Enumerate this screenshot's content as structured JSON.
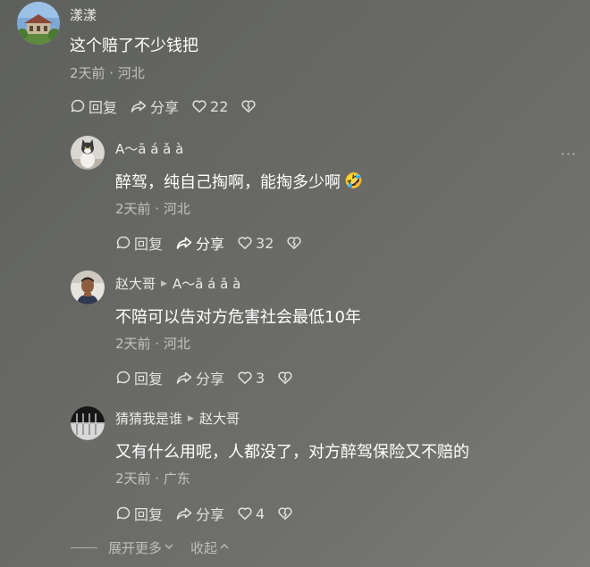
{
  "comments": [
    {
      "username": "漾漾",
      "text": "这个赔了不少钱把",
      "meta": "2天前 · 河北",
      "reply_label": "回复",
      "share_label": "分享",
      "like_count": "22"
    },
    {
      "username": "A～ā á ǎ à",
      "text": "醉驾，纯自己掏啊，能掏多少啊",
      "emoji": "🤣",
      "meta": "2天前 · 河北",
      "reply_label": "回复",
      "share_label": "分享",
      "like_count": "32"
    },
    {
      "username": "赵大哥",
      "reply_to": "A～ā á ǎ à",
      "text": "不陪可以告对方危害社会最低10年",
      "meta": "2天前 · 河北",
      "reply_label": "回复",
      "share_label": "分享",
      "like_count": "3"
    },
    {
      "username": "猜猜我是谁",
      "reply_to": "赵大哥",
      "text": "又有什么用呢，人都没了，对方醉驾保险又不赔的",
      "meta": "2天前 · 广东",
      "reply_label": "回复",
      "share_label": "分享",
      "like_count": "4"
    }
  ],
  "more_button": "···",
  "footer": {
    "expand_label": "展开更多",
    "collapse_label": "收起"
  },
  "icons": {
    "reply": "comment-bubble-icon",
    "share": "share-arrow-icon",
    "like": "heart-icon",
    "dislike": "broken-heart-icon",
    "reply_arrow": "triangle-right-icon"
  }
}
